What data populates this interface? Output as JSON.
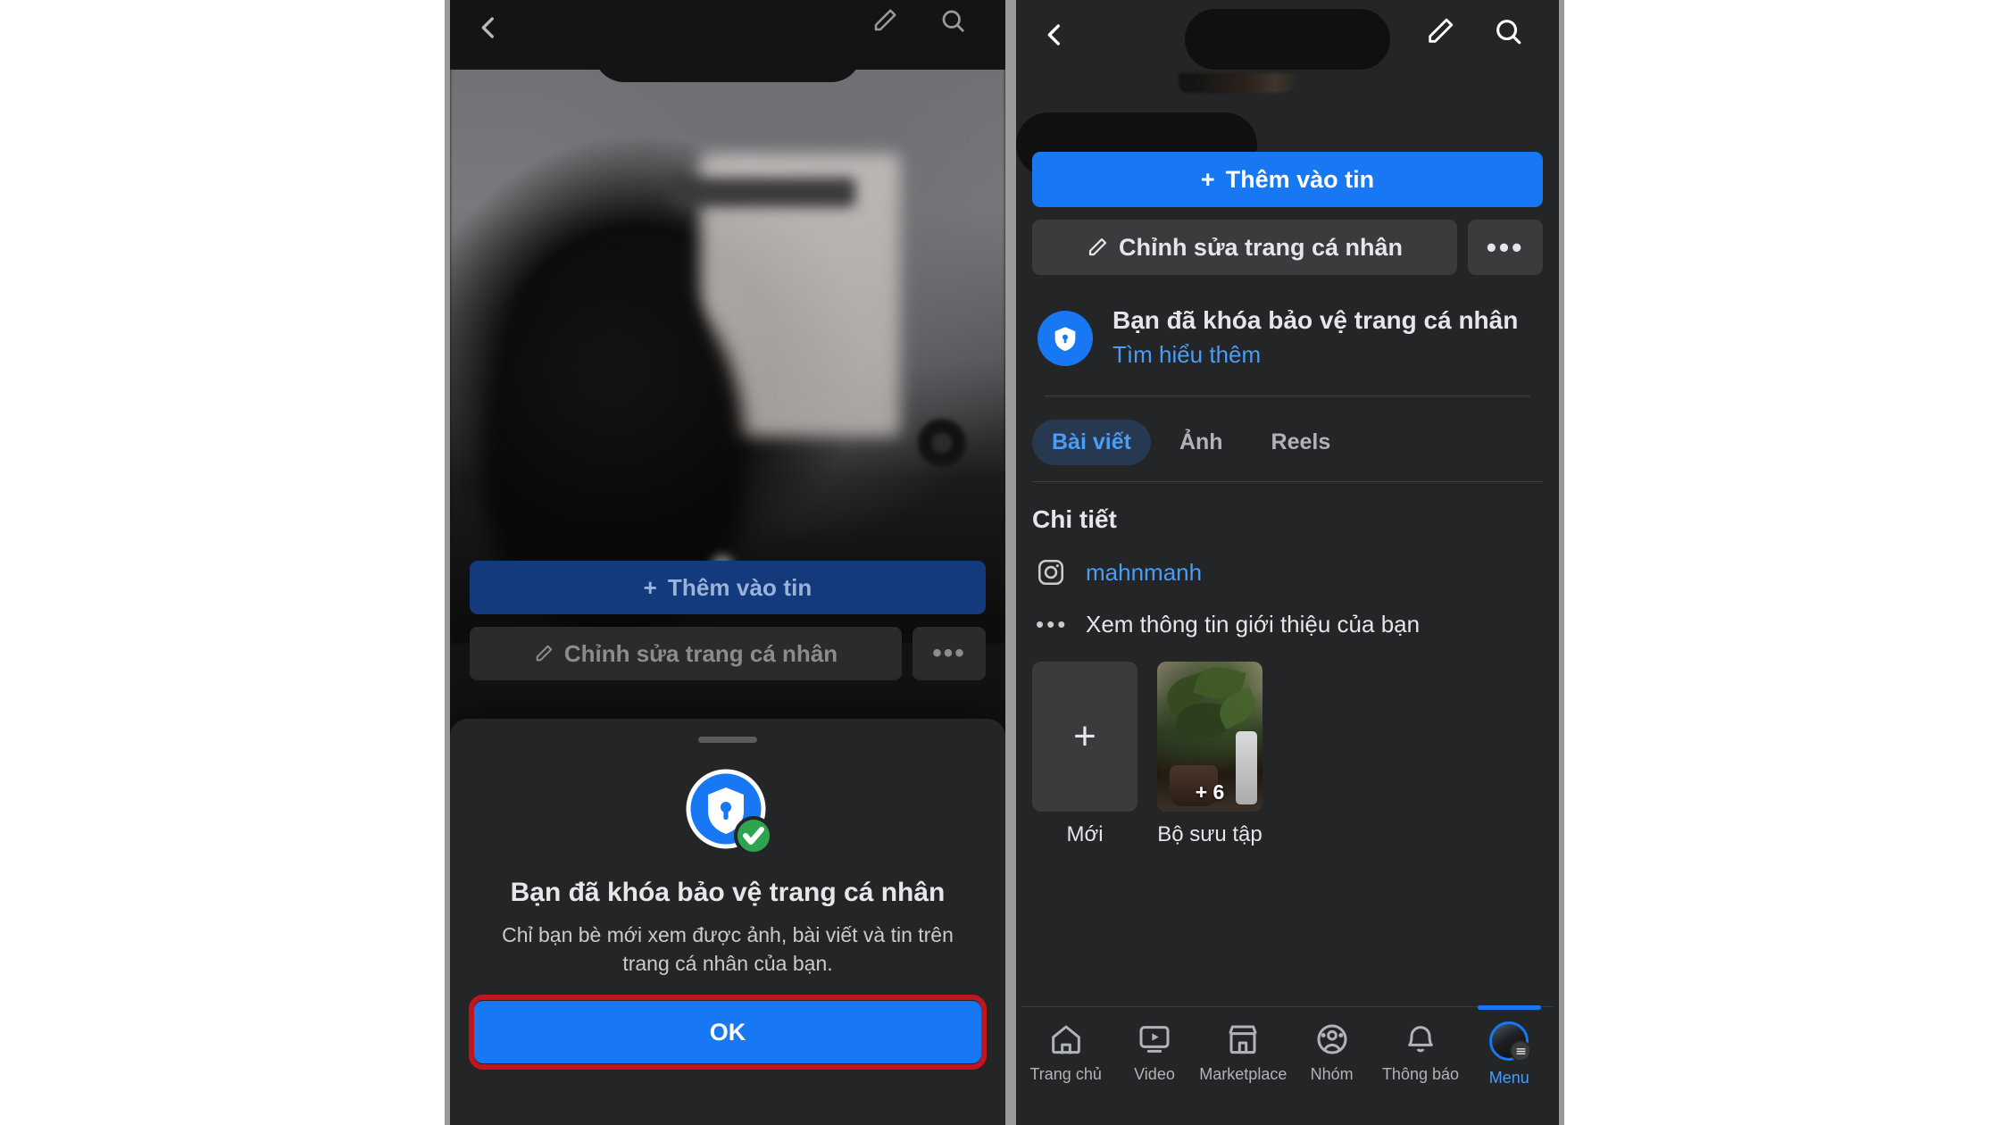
{
  "left_phone": {
    "topbar": {
      "back_icon": "chevron-left-icon",
      "edit_icon": "pencil-icon",
      "search_icon": "search-icon"
    },
    "actions": {
      "add_story_label": "Thêm vào tin",
      "add_story_plus": "+",
      "edit_profile_label": "Chỉnh sửa trang cá nhân",
      "more_label": "•••"
    },
    "sheet": {
      "icon": "shield-lock-check-icon",
      "title": "Bạn đã khóa bảo vệ trang cá nhân",
      "body": "Chỉ bạn bè mới xem được ảnh, bài viết và tin trên trang cá nhân của bạn.",
      "ok_label": "OK",
      "highlight_color": "#c0161c",
      "ok_color": "#1877f2"
    }
  },
  "right_phone": {
    "topbar": {
      "back_icon": "chevron-left-icon",
      "edit_icon": "pencil-icon",
      "search_icon": "search-icon"
    },
    "actions": {
      "add_story_label": "Thêm vào tin",
      "add_story_plus": "+",
      "edit_profile_label": "Chỉnh sửa trang cá nhân",
      "more_label": "•••"
    },
    "lock_notice": {
      "icon": "shield-lock-icon",
      "title": "Bạn đã khóa bảo vệ trang cá nhân",
      "link_label": "Tìm hiểu thêm",
      "link_color": "#4a9cf6"
    },
    "tabs": [
      {
        "label": "Bài viết",
        "active": true
      },
      {
        "label": "Ảnh",
        "active": false
      },
      {
        "label": "Reels",
        "active": false
      }
    ],
    "details": {
      "section_title": "Chi tiết",
      "items": [
        {
          "icon": "instagram-icon",
          "label": "mahnmanh",
          "is_link": true
        },
        {
          "icon": "ellipsis-icon",
          "label": "Xem thông tin giới thiệu của bạn",
          "is_link": false
        }
      ]
    },
    "tiles": [
      {
        "caption": "Mới",
        "type": "add",
        "glyph": "+",
        "overlay": ""
      },
      {
        "caption": "Bộ sưu tập",
        "type": "photo",
        "glyph": "",
        "overlay": "+ 6"
      }
    ],
    "bottom_nav": [
      {
        "label": "Trang chủ",
        "icon": "home-icon",
        "active": false
      },
      {
        "label": "Video",
        "icon": "video-icon",
        "active": false
      },
      {
        "label": "Marketplace",
        "icon": "marketplace-icon",
        "active": false
      },
      {
        "label": "Nhóm",
        "icon": "groups-icon",
        "active": false
      },
      {
        "label": "Thông báo",
        "icon": "bell-icon",
        "active": false
      },
      {
        "label": "Menu",
        "icon": "menu-avatar-icon",
        "active": true
      }
    ]
  }
}
